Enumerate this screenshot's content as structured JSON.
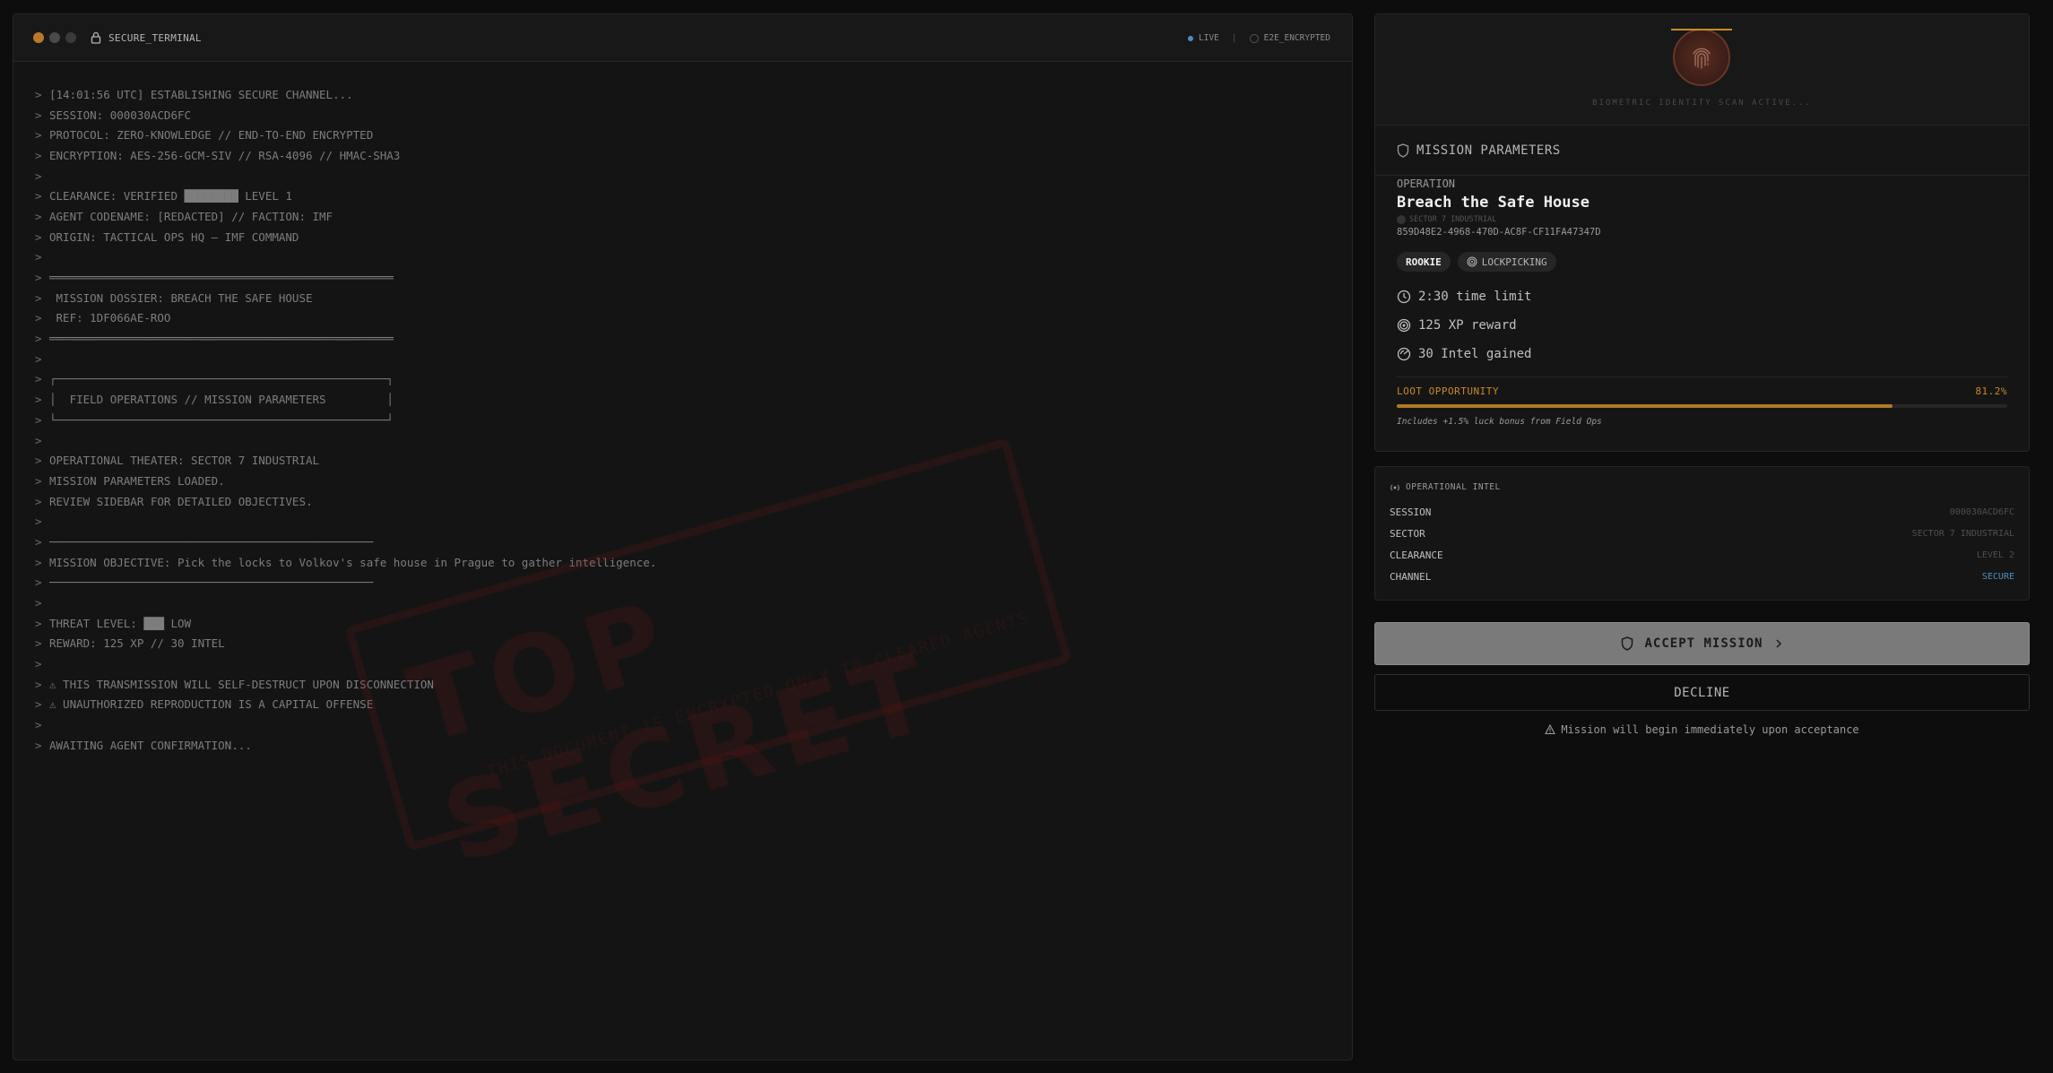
{
  "terminal": {
    "title": "SECURE_TERMINAL",
    "status_live": "LIVE",
    "status_sep": "|",
    "status_e2e": "E2E_ENCRYPTED",
    "lines": [
      "[14:01:56 UTC] ESTABLISHING SECURE CHANNEL...",
      "SESSION: 000030ACD6FC",
      "PROTOCOL: ZERO-KNOWLEDGE // END-TO-END ENCRYPTED",
      "ENCRYPTION: AES-256-GCM-SIV // RSA-4096 // HMAC-SHA3",
      "",
      "CLEARANCE: VERIFIED ████████ LEVEL 1",
      "AGENT CODENAME: [REDACTED] // FACTION: IMF",
      "ORIGIN: TACTICAL OPS HQ — IMF COMMAND",
      "",
      "═══════════════════════════════════════════════════",
      " MISSION DOSSIER: BREACH THE SAFE HOUSE",
      " REF: 1DF066AE-ROO",
      "═══════════════════════════════════════════════════",
      "",
      "┌─────────────────────────────────────────────────┐",
      "│  FIELD OPERATIONS // MISSION PARAMETERS         │",
      "└─────────────────────────────────────────────────┘",
      "",
      "OPERATIONAL THEATER: SECTOR 7 INDUSTRIAL",
      "MISSION PARAMETERS LOADED.",
      "REVIEW SIDEBAR FOR DETAILED OBJECTIVES.",
      "",
      "────────────────────────────────────────────────",
      "MISSION OBJECTIVE: Pick the locks to Volkov's safe house in Prague to gather intelligence.",
      "────────────────────────────────────────────────",
      "",
      "THREAT LEVEL: ███ LOW",
      "REWARD: 125 XP // 30 INTEL",
      "",
      "⚠ THIS TRANSMISSION WILL SELF-DESTRUCT UPON DISCONNECTION",
      "⚠ UNAUTHORIZED REPRODUCTION IS A CAPITAL OFFENSE",
      "",
      "AWAITING AGENT CONFIRMATION..."
    ],
    "prompt": ">",
    "watermark": "TOP SECRET",
    "watermark_sub": "THIS DOCUMENT IS ENCRYPTED ONLY TO CLEARED AGENTS"
  },
  "bio": {
    "scan_text": "BIOMETRIC IDENTITY SCAN ACTIVE..."
  },
  "mission": {
    "header": "MISSION PARAMETERS",
    "operation_label": "OPERATION",
    "operation_name": "Breach the Safe House",
    "sector": "SECTOR 7 INDUSTRIAL",
    "uuid": "859D48E2-4968-470D-AC8F-CF11FA47347D",
    "rank_badge": "ROOKIE",
    "skill_badge": "LOCKPICKING",
    "time_limit": "2:30 time limit",
    "xp_reward": "125 XP reward",
    "intel_gained": "30 Intel gained",
    "loot_label": "LOOT OPPORTUNITY",
    "loot_value": "81.2%",
    "loot_fraction": 0.812,
    "loot_note": "Includes +1.5% luck bonus from Field Ops"
  },
  "intel": {
    "header": "OPERATIONAL INTEL",
    "rows": [
      {
        "key": "SESSION",
        "value": "000030ACD6FC"
      },
      {
        "key": "SECTOR",
        "value": "SECTOR 7 INDUSTRIAL"
      },
      {
        "key": "CLEARANCE",
        "value": "LEVEL 2"
      },
      {
        "key": "CHANNEL",
        "value": "SECURE"
      }
    ]
  },
  "actions": {
    "accept_label": "ACCEPT MISSION",
    "decline_label": "DECLINE",
    "warning": "Mission will begin immediately upon acceptance"
  },
  "colors": {
    "accent": "#c98a2a",
    "secure": "#4a8fc4",
    "stamp": "#6e1919"
  }
}
